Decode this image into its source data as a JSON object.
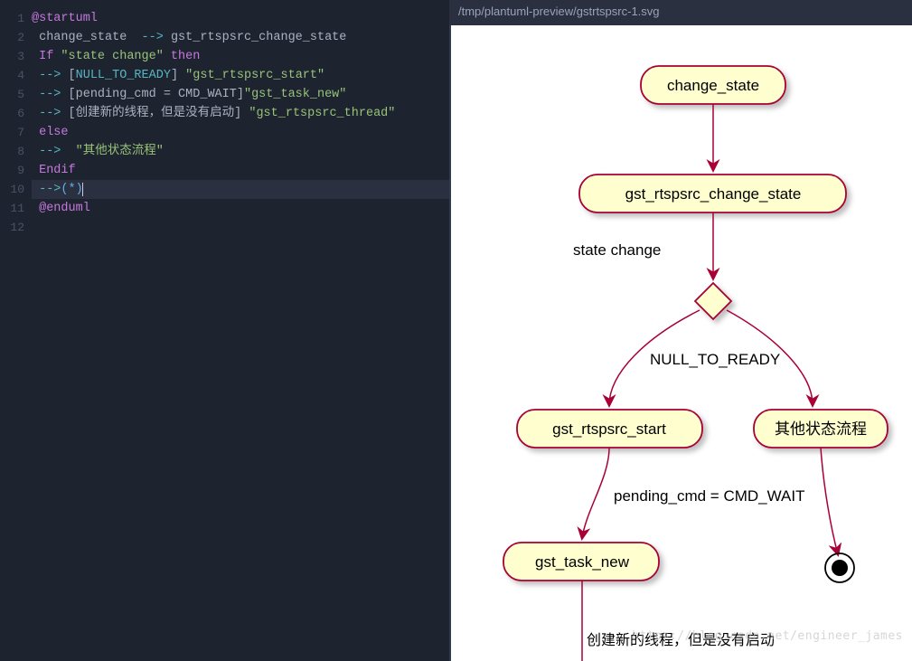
{
  "editor": {
    "lines": {
      "n1": "1",
      "n2": "2",
      "n3": "3",
      "n4": "4",
      "n5": "5",
      "n6": "6",
      "n7": "7",
      "n8": "8",
      "n9": "9",
      "n10": "10",
      "n11": "11",
      "n12": "12"
    },
    "l1_tag": "@startuml",
    "l2_a": " change_state  ",
    "l2_arrow": "-->",
    "l2_b": " gst_rtspsrc_change_state",
    "l3_a": " If ",
    "l3_cond": "\"state change\"",
    "l3_then": " then",
    "l4_arr": " --> ",
    "l4_br_o": "[",
    "l4_enum": "NULL_TO_READY",
    "l4_br_c": "]",
    "l4_sp": " ",
    "l4_str": "\"gst_rtspsrc_start\"",
    "l5_arr": " --> ",
    "l5_br_o": "[",
    "l5_cond": "pending_cmd = CMD_WAIT",
    "l5_br_c": "]",
    "l5_str": "\"gst_task_new\"",
    "l6_arr": " --> ",
    "l6_br_o": "[",
    "l6_cond": "创建新的线程，但是没有启动",
    "l6_br_c": "]",
    "l6_sp": " ",
    "l6_str": "\"gst_rtspsrc_thread\"",
    "l7": " else",
    "l8_arr": " -->  ",
    "l8_str": "\"其他状态流程\"",
    "l9": " Endif",
    "l10_arr": " -->",
    "l10_p": "(*)",
    "l11_tag": " @enduml"
  },
  "preview": {
    "path": "/tmp/plantuml-preview/gstrtspsrc-1.svg",
    "node_change_state": "change_state",
    "node_change_state_fn": "gst_rtspsrc_change_state",
    "label_state_change": "state change",
    "label_null_to_ready": "NULL_TO_READY",
    "node_start": "gst_rtspsrc_start",
    "node_other": "其他状态流程",
    "label_pending": "pending_cmd = CMD_WAIT",
    "node_task_new": "gst_task_new",
    "label_thread": "创建新的线程，但是没有启动"
  },
  "watermark": "https://blog.csdn.net/engineer_james"
}
